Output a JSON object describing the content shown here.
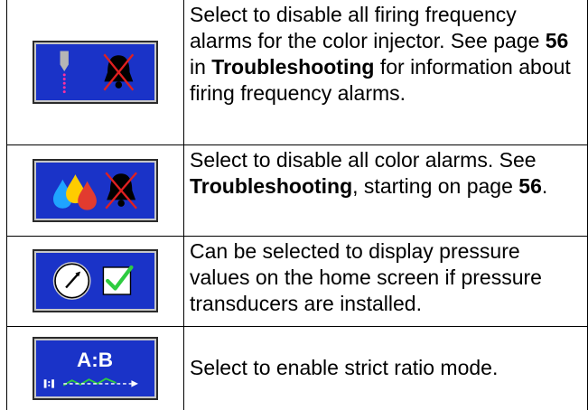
{
  "rows": [
    {
      "icon": "firing-frequency-alarm-disable-icon",
      "desc": {
        "p1": "Select to disable all firing frequency alarms for the color injector. See page ",
        "b1": "56",
        "p2": " in ",
        "b2": "Troubleshooting",
        "p3": " for information about firing frequency alarms."
      }
    },
    {
      "icon": "color-alarm-disable-icon",
      "desc": {
        "p1": "Select to disable all color alarms. See ",
        "b1": "Troubleshooting",
        "p2": ", starting on page ",
        "b2": "56",
        "p3": "."
      }
    },
    {
      "icon": "pressure-display-checkbox-icon",
      "desc": {
        "p1": "Can be selected to display pressure values on the home screen if pressure transducers are installed."
      }
    },
    {
      "icon": "strict-ratio-mode-icon",
      "icon_text": "A:B",
      "desc": {
        "p1": "Select to enable strict ratio mode."
      }
    }
  ],
  "colors": {
    "button_blue": "#1a33c8",
    "alarm_x_red": "#e02020",
    "check_green": "#2ecc40"
  }
}
